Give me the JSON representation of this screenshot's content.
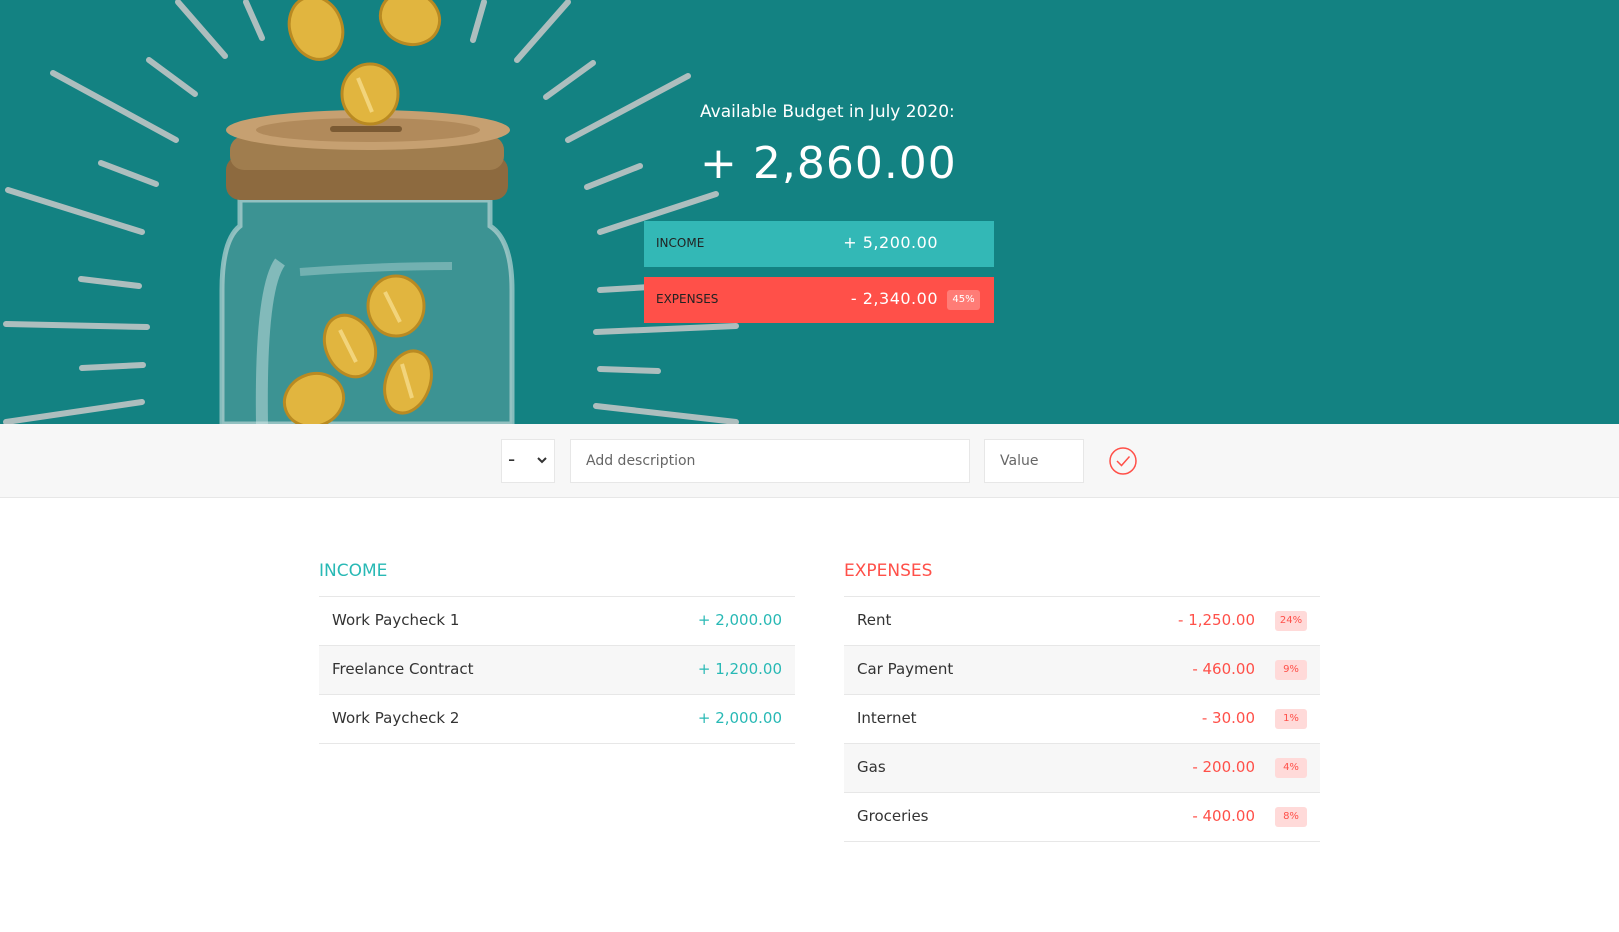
{
  "header": {
    "budget_title": "Available Budget in July 2020:",
    "budget_value": "+ 2,860.00",
    "income_label": "Income",
    "income_value": "+ 5,200.00",
    "expenses_label": "Expenses",
    "expenses_value": "- 2,340.00",
    "expenses_percentage": "45%"
  },
  "add_form": {
    "type_selected": "-",
    "type_options": [
      "+",
      "-"
    ],
    "description_placeholder": "Add description",
    "value_placeholder": "Value",
    "submit_icon": "checkmark-circle-icon"
  },
  "income": {
    "title": "Income",
    "items": [
      {
        "description": "Work Paycheck 1",
        "value": "+ 2,000.00"
      },
      {
        "description": "Freelance Contract",
        "value": "+ 1,200.00"
      },
      {
        "description": "Work Paycheck 2",
        "value": "+ 2,000.00"
      }
    ]
  },
  "expenses": {
    "title": "Expenses",
    "items": [
      {
        "description": "Rent",
        "value": "- 1,250.00",
        "percentage": "24%"
      },
      {
        "description": "Car Payment",
        "value": "- 460.00",
        "percentage": "9%"
      },
      {
        "description": "Internet",
        "value": "- 30.00",
        "percentage": "1%"
      },
      {
        "description": "Gas",
        "value": "- 200.00",
        "percentage": "4%"
      },
      {
        "description": "Groceries",
        "value": "- 400.00",
        "percentage": "8%"
      }
    ]
  },
  "colors": {
    "header_background": "#138282",
    "income_accent": "#28b9b5",
    "expenses_accent": "#ff5049"
  }
}
